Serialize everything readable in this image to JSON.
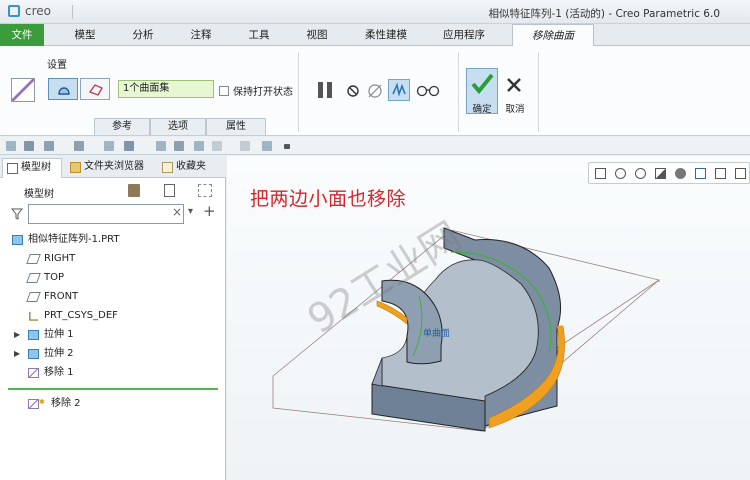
{
  "app": {
    "logo": "creo",
    "window_title": "相似特征阵列-1 (活动的) - Creo Parametric 6.0"
  },
  "menu": {
    "tabs": [
      "文件",
      "模型",
      "分析",
      "注释",
      "工具",
      "视图",
      "柔性建模",
      "应用程序",
      "移除曲面"
    ]
  },
  "ribbon": {
    "settings_label": "设置",
    "surface_set": "1个曲面集",
    "keep_open": "保持打开状态",
    "subtabs": [
      "参考",
      "选项",
      "属性"
    ],
    "ok_label": "确定",
    "cancel_label": "取消"
  },
  "left_panel": {
    "tabs": [
      "模型树",
      "文件夹浏览器",
      "收藏夹"
    ],
    "tree_header": "模型树",
    "filter_placeholder": "",
    "items": [
      "相似特征阵列-1.PRT",
      "RIGHT",
      "TOP",
      "FRONT",
      "PRT_CSYS_DEF",
      "拉伸 1",
      "拉伸 2",
      "移除 1",
      "移除 2"
    ]
  },
  "viewport": {
    "annotation": "把两边小面也移除",
    "surface_tag": "单曲面",
    "watermark": "92工业网"
  },
  "colors": {
    "accent_green": "#3c9b3c",
    "annotation_red": "#d4262a",
    "highlight_orange": "#f0a020",
    "select_blue": "#c7def0"
  }
}
